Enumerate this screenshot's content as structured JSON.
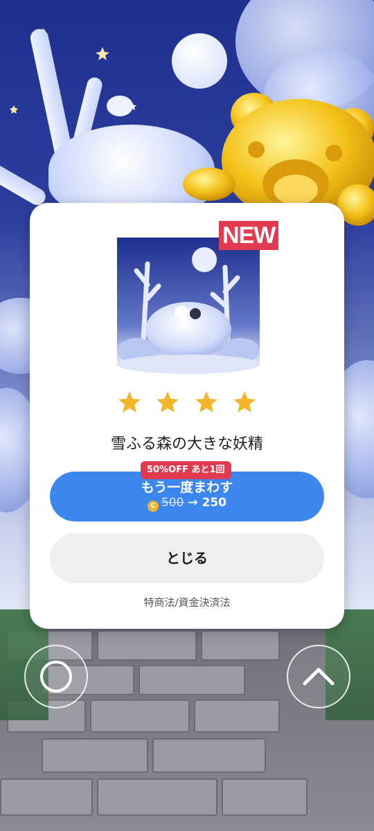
{
  "reward": {
    "new_badge": "NEW",
    "rarity_stars": 4,
    "title": "雪ふる森の大きな妖精"
  },
  "spin_again": {
    "badge": "50%OFF あと1回",
    "label": "もう一度まわす",
    "old_price": "500",
    "arrow": "→",
    "new_price": "250"
  },
  "close_button": {
    "label": "とじる"
  },
  "legal_link": "特商法/資金決済法",
  "controls": {
    "left_icon": "circle-icon",
    "right_icon": "chevron-up-icon"
  },
  "colors": {
    "primary_button": "#3d86ee",
    "badge_red": "#e23a4f",
    "star_gold": "#f3b52c",
    "close_button": "#efefef"
  }
}
